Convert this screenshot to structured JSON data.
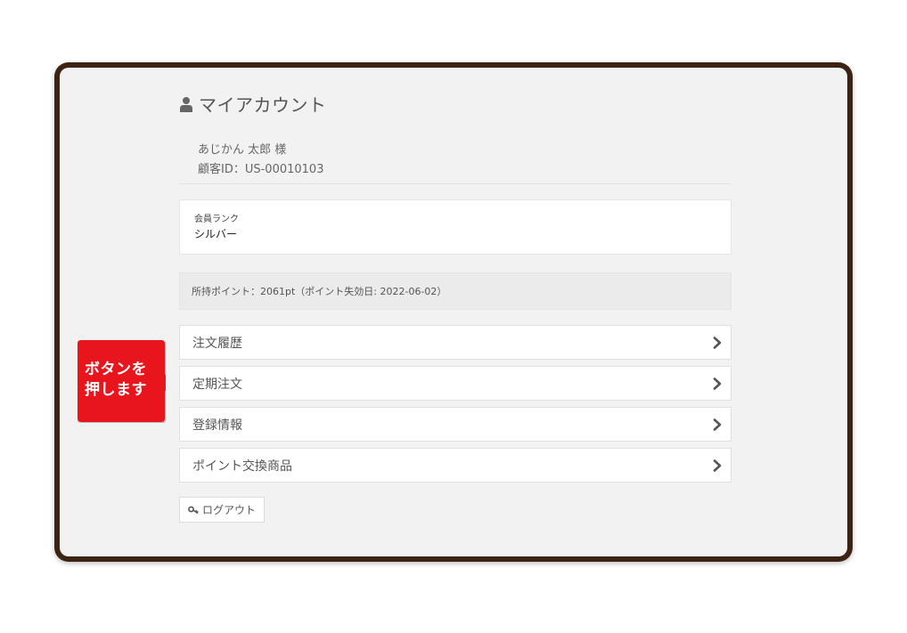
{
  "header": {
    "title": "マイアカウント",
    "icon": "user-icon"
  },
  "customer": {
    "name": "あじかん 太郎 様",
    "id_line": "顧客ID：US-00010103"
  },
  "rank": {
    "label": "会員ランク",
    "value": "シルバー"
  },
  "points": {
    "text": "所持ポイント：2061pt（ポイント失効日: 2022-06-02）"
  },
  "menu": {
    "items": [
      {
        "label": "注文履歴",
        "icon": "chevron-right-icon"
      },
      {
        "label": "定期注文",
        "icon": "chevron-right-icon"
      },
      {
        "label": "登録情報",
        "icon": "chevron-right-icon"
      },
      {
        "label": "ポイント交換商品",
        "icon": "chevron-right-icon"
      }
    ]
  },
  "logout": {
    "label": "ログアウト",
    "icon": "key-icon"
  },
  "callout": {
    "line1": "ボタンを",
    "line2": "押します",
    "color": "#e8191c"
  },
  "colors": {
    "frame": "#3d2314",
    "panel": "#f2f2f2",
    "callout": "#e8191c"
  }
}
